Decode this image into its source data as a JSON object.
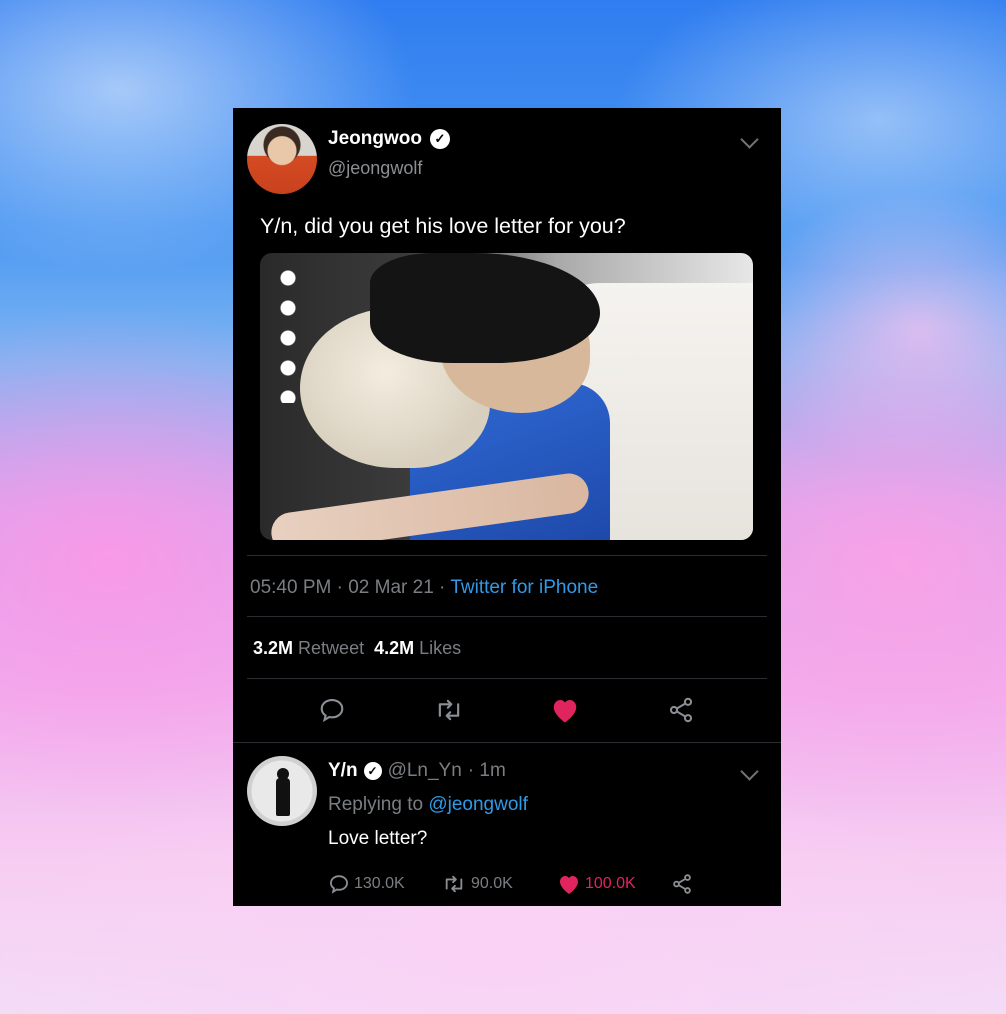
{
  "tweet": {
    "author_name": "Jeongwoo",
    "author_handle": "@jeongwolf",
    "text": "Y/n, did you get his love letter for you?",
    "time": "05:40 PM",
    "separator": " · ",
    "date": "02 Mar 21",
    "source": "Twitter for iPhone",
    "retweet_count": "3.2M",
    "retweet_label": "Retweet",
    "like_count": "4.2M",
    "like_label": "Likes",
    "liked": true
  },
  "reply": {
    "author_name": "Y/n",
    "author_handle": "@Ln_Yn",
    "age": "· 1m",
    "replying_prefix": "Replying to",
    "replying_to": "@jeongwolf",
    "text": "Love letter?",
    "reply_count": "130.0K",
    "retweet_count": "90.0K",
    "like_count": "100.0K"
  },
  "colors": {
    "background": "#000000",
    "accent_link": "#2f9be8",
    "like": "#e0245e",
    "muted": "#7a7e83"
  },
  "icons": [
    "verified-icon",
    "chevron-down-icon",
    "reply-icon",
    "retweet-icon",
    "heart-icon",
    "share-icon"
  ]
}
